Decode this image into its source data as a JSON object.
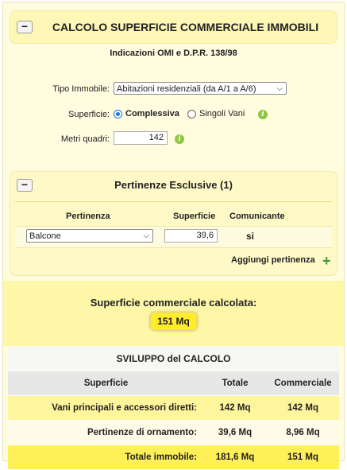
{
  "header": {
    "collapse_label": "−",
    "title": "CALCOLO SUPERFICIE COMMERCIALE IMMOBILI"
  },
  "subtitle": "Indicazioni OMI e D.P.R. 138/98",
  "form": {
    "tipo_label": "Tipo Immobile:",
    "tipo_value": "Abitazioni residenziali (da A/1 a A/6)",
    "superficie_label": "Superficie:",
    "radio_complessiva": "Complessiva",
    "radio_singoli": "Singoli Vani",
    "metri_label": "Metri quadri:",
    "metri_value": "142"
  },
  "pertinenze": {
    "collapse_label": "−",
    "title": "Pertinenze Esclusive (1)",
    "col_pertinenza": "Pertinenza",
    "col_superficie": "Superficie",
    "col_comunicante": "Comunicante",
    "row_type": "Balcone",
    "row_superficie": "39,6",
    "row_comunicante": "si",
    "add_label": "Aggiungi pertinenza"
  },
  "result": {
    "title": "Superficie commerciale calcolata:",
    "value": "151 Mq"
  },
  "sviluppo": {
    "title": "SVILUPPO del CALCOLO",
    "headers": [
      "Superficie",
      "Totale",
      "Commerciale"
    ],
    "rows": [
      [
        "Vani principali e accessori diretti:",
        "142 Mq",
        "142 Mq"
      ],
      [
        "Pertinenze di ornamento:",
        "39,6 Mq",
        "8,96 Mq"
      ],
      [
        "Totale immobile:",
        "181,6 Mq",
        "151 Mq"
      ]
    ]
  },
  "icons": {
    "info": "info-icon",
    "add": "plus-icon",
    "dropdown": "chevron-down-icon",
    "collapse": "minus-icon"
  },
  "colors": {
    "panel": "#fffce0",
    "header": "#fff7b5",
    "result": "#fff7a8",
    "badge": "#ffec2e",
    "info": "#8dc63f",
    "add": "#3a9b2a"
  }
}
